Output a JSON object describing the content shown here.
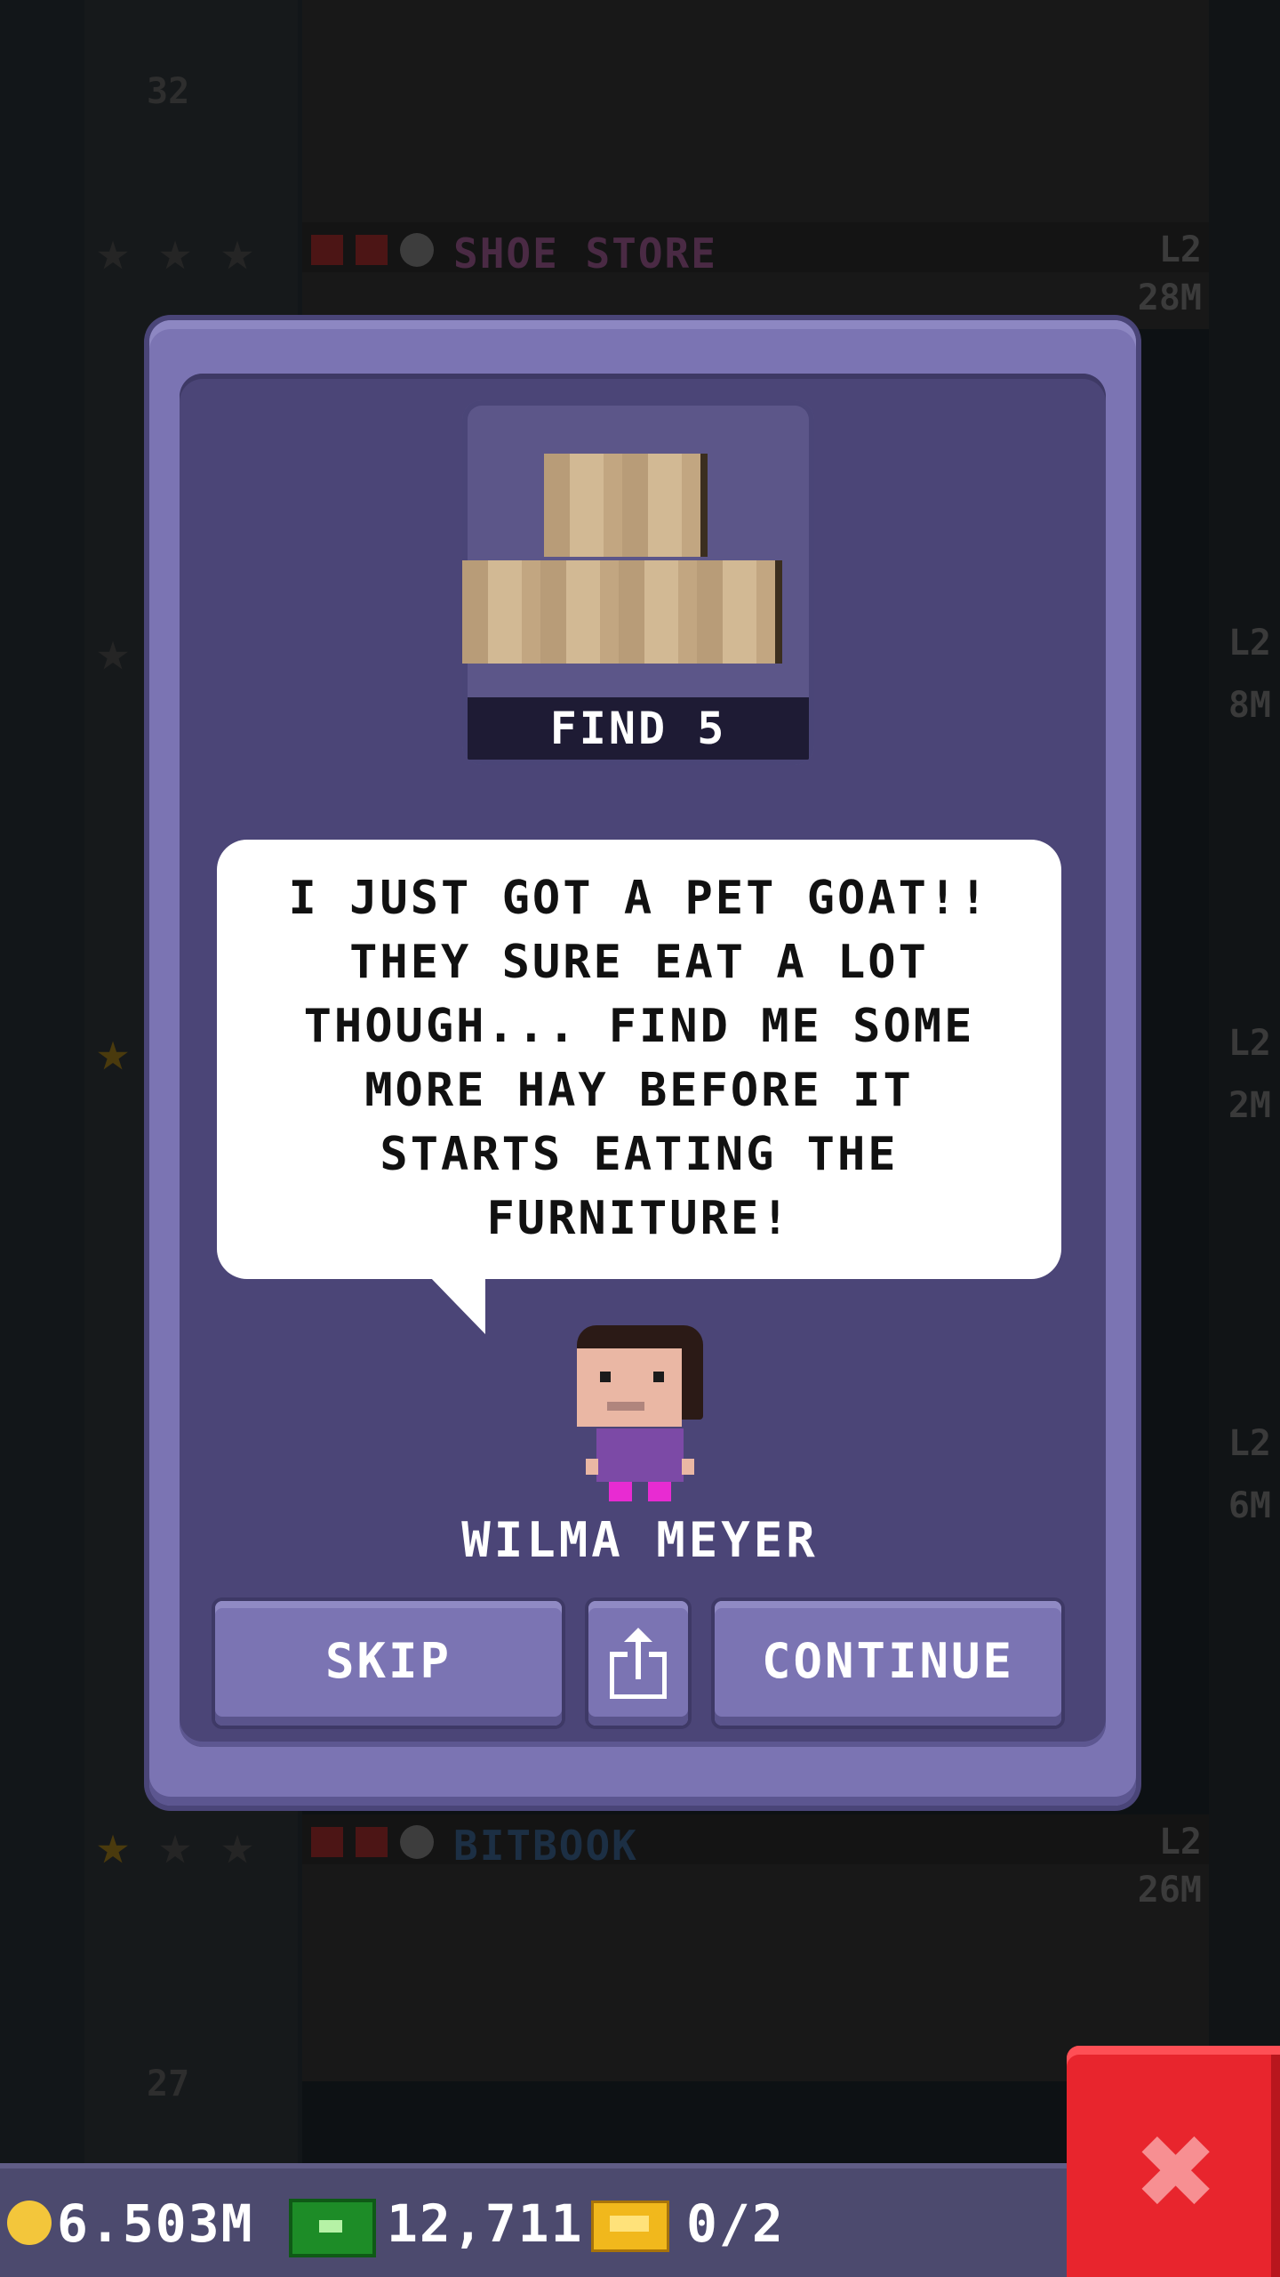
{
  "background": {
    "floors": [
      {
        "name": "SHOE STORE",
        "name_color": "#4a2a44",
        "level": "L2",
        "amount": "28M",
        "stars_gold": 0
      },
      {
        "name": "BITBOOK",
        "name_color": "#1c2f44",
        "level": "L2",
        "amount": "26M",
        "stars_gold": 1
      }
    ],
    "floor_number_top": "32",
    "floor_number_bottom": "27",
    "side_levels": [
      "L2",
      "8M",
      "L2",
      "2M",
      "L2",
      "6M"
    ]
  },
  "modal": {
    "item_label": "FIND 5",
    "item_icon": "hay-bales-icon",
    "speech": "I JUST GOT A PET GOAT!!\nTHEY SURE EAT A LOT\nTHOUGH... FIND ME SOME\nMORE HAY BEFORE IT\nSTARTS EATING THE\nFURNITURE!",
    "npc_name": "WILMA MEYER",
    "buttons": {
      "skip": "SKIP",
      "share_icon": "share-icon",
      "continue": "CONTINUE"
    }
  },
  "statusbar": {
    "coins": "6.503M",
    "bux": "12,711",
    "tickets": "0/2"
  },
  "colors": {
    "modal_outer": "#7b74b3",
    "modal_inner": "#4b4577",
    "close_red": "#e8252d"
  }
}
